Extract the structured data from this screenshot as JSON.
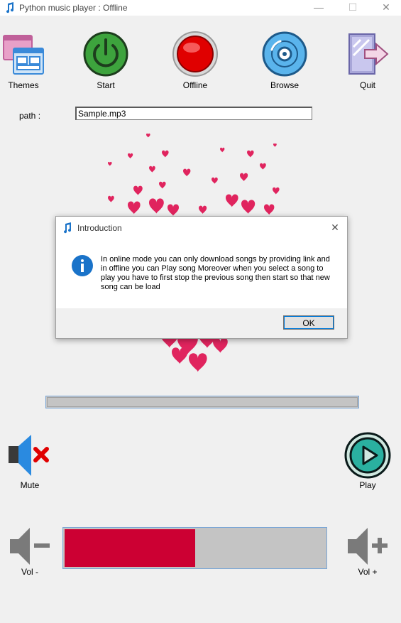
{
  "window": {
    "title": "Python music player : Offline",
    "minimize_glyph": "—",
    "maximize_glyph": "☐",
    "close_glyph": "✕"
  },
  "toolbar": {
    "themes_label": "Themes",
    "start_label": "Start",
    "offline_label": "Offline",
    "browse_label": "Browse",
    "quit_label": "Quit"
  },
  "path": {
    "label": "path :",
    "value": "Sample.mp3"
  },
  "controls": {
    "mute_label": "Mute",
    "play_label": "Play",
    "vol_down_label": "Vol -",
    "vol_up_label": "Vol +"
  },
  "volume": {
    "level": 0.5,
    "fill_color": "#cc0033",
    "track_color": "#c4c4c4"
  },
  "progress": {
    "level": 0
  },
  "dialog": {
    "title": "Introduction",
    "message": "In online mode you can only download songs by providing link and in offline you can Play song Moreover when you select a song to play you have to first stop the previous song then start so that new song can be load",
    "ok_label": "OK",
    "close_glyph": "✕"
  },
  "colors": {
    "accent": "#0078d7",
    "heart": "#e0245e",
    "start_green": "#2e8b2e",
    "offline_red": "#e00000",
    "browse_blue": "#3a9ad9"
  }
}
